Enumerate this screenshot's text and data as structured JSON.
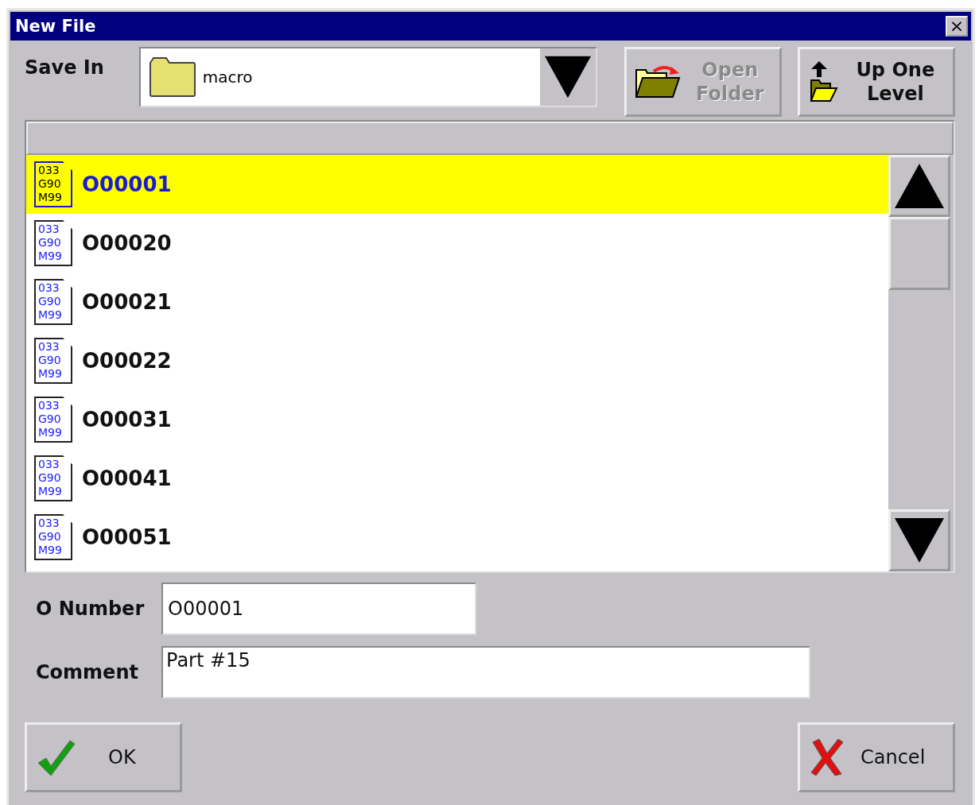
{
  "window": {
    "title": "New File",
    "close": "×"
  },
  "save_in": {
    "label": "Save In",
    "value": "macro"
  },
  "toolbar": [
    {
      "kind": "open",
      "label": "Open Folder",
      "disabled": true
    },
    {
      "kind": "up",
      "label": "Up One Level",
      "disabled": false
    }
  ],
  "files": [
    {
      "name": "O00001",
      "icon_lines": [
        "033",
        "G90",
        "M99"
      ],
      "selected": true
    },
    {
      "name": "O00020",
      "icon_lines": [
        "033",
        "G90",
        "M99"
      ],
      "selected": false
    },
    {
      "name": "O00021",
      "icon_lines": [
        "033",
        "G90",
        "M99"
      ],
      "selected": false
    },
    {
      "name": "O00022",
      "icon_lines": [
        "033",
        "G90",
        "M99"
      ],
      "selected": false
    },
    {
      "name": "O00031",
      "icon_lines": [
        "033",
        "G90",
        "M99"
      ],
      "selected": false
    },
    {
      "name": "O00041",
      "icon_lines": [
        "033",
        "G90",
        "M99"
      ],
      "selected": false
    },
    {
      "name": "O00051",
      "icon_lines": [
        "033",
        "G90",
        "M99"
      ],
      "selected": false
    }
  ],
  "o_number": {
    "label": "O Number",
    "value": "O00001"
  },
  "comment": {
    "label": "Comment",
    "value": "Part #15"
  },
  "buttons": [
    {
      "kind": "ok",
      "label": "OK"
    },
    {
      "kind": "cancel",
      "label": "Cancel"
    }
  ]
}
